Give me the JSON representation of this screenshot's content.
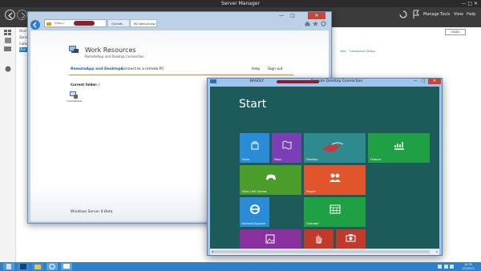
{
  "server_manager": {
    "title": "Server Manager",
    "menu": [
      "Manage",
      "Tools",
      "View",
      "Help"
    ],
    "nav_items": [
      "Overv",
      "Serve",
      "Collec",
      "Ove"
    ],
    "tasks_label": "TASKS",
    "panel_text": [
      "User",
      "Connection Status"
    ],
    "window_controls": "— □ ✕"
  },
  "browser": {
    "tabs": [
      "QuickW...",
      "RD Web Access"
    ],
    "address_prefix": "https://",
    "window_controls": {
      "minimize": "—",
      "maximize": "□",
      "close": "✕"
    }
  },
  "web_access": {
    "title": "Work Resources",
    "subtitle": "RemoteApp and Desktop Connection",
    "nav": {
      "remoteapp": "RemoteApp and Desktops",
      "connect": "Connect to a remote PC",
      "help": "Help",
      "signout": "Sign out"
    },
    "current_folder": "Current folder: /",
    "app_label": "QuickWriteA...",
    "footer": "Windows Server 8 Beta"
  },
  "rdc": {
    "title_prefix": "BASOLY",
    "title_suffix": "- Remote Desktop Connection",
    "controls": {
      "minimize": "—",
      "maximize": "□",
      "close": "✕"
    },
    "start_label": "Start",
    "tiles": [
      {
        "key": "store",
        "label": "Store",
        "color": "#2a8bd6"
      },
      {
        "key": "maps",
        "label": "Maps",
        "color": "#7a3fb4"
      },
      {
        "key": "desktop",
        "label": "Desktop",
        "color": "#2e8a8e"
      },
      {
        "key": "finance",
        "label": "Finance",
        "color": "#20a045"
      },
      {
        "key": "xbox",
        "label": "Xbox LIVE Games",
        "color": "#4a9d2a"
      },
      {
        "key": "people",
        "label": "People",
        "color": "#e0552b"
      },
      {
        "key": "ie",
        "label": "Internet Explorer",
        "color": "#2a8bd6"
      },
      {
        "key": "calendar",
        "label": "Calendar",
        "color": "#20a045"
      },
      {
        "key": "photos",
        "label": "",
        "color": "#8a2f9e"
      },
      {
        "key": "app2",
        "label": "",
        "color": "#c0392b"
      },
      {
        "key": "camera",
        "label": "",
        "color": "#c0392b"
      }
    ]
  },
  "taskbar": {
    "clock_time": "10:55",
    "clock_date": "3/1/2012"
  }
}
